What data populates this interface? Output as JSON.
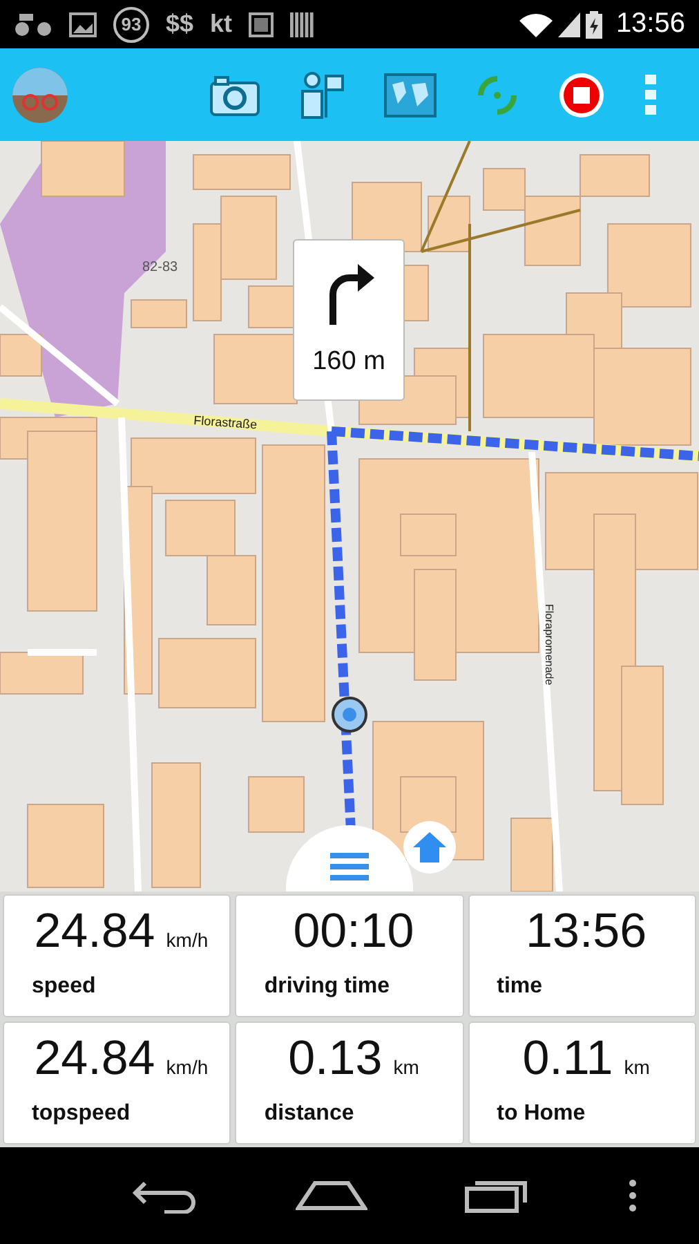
{
  "status_bar": {
    "notifications": [
      "93",
      "$$",
      "kt"
    ],
    "time": "13:56"
  },
  "map": {
    "labels": [
      {
        "text": "82-83",
        "kind": "number"
      },
      {
        "text": "Florastraße",
        "kind": "street"
      },
      {
        "text": "Florapromenade",
        "kind": "vertical"
      }
    ],
    "turn": {
      "distance": "160 m"
    }
  },
  "stats": [
    {
      "value": "24.84",
      "unit": "km/h",
      "label": "speed"
    },
    {
      "value": "00:10",
      "label": "driving time"
    },
    {
      "value": "13:56",
      "label": "time"
    },
    {
      "value": "24.84",
      "unit": "km/h",
      "label": "topspeed"
    },
    {
      "value": "0.13",
      "unit": "km",
      "label": "distance"
    },
    {
      "value": "0.11",
      "unit": "km",
      "label": "to Home"
    }
  ]
}
